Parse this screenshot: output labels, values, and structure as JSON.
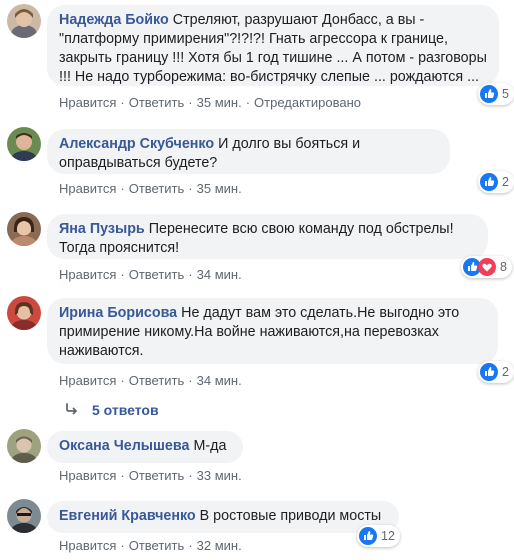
{
  "comments": [
    {
      "author": "Надежда Бойко",
      "text": "Стреляют, разрушают Донбасс, а вы - \"платформу примирения\"?!?!?! Гнать агрессора к границе, закрыть границу !!! Хотя бы 1 год тишине ... А потом - разговоры !!! Не надо турборежима: во-бистрячку слепые ... рождаются ...",
      "like": "Нравится",
      "reply": "Ответить",
      "time": "35 мин.",
      "edited": "Отредактировано",
      "reactions_count": "5",
      "reactions": [
        "like-icon"
      ]
    },
    {
      "author": "Александр Скубченко",
      "text": "И долго вы бояться и оправдываться будете?",
      "like": "Нравится",
      "reply": "Ответить",
      "time": "35 мин.",
      "reactions_count": "2",
      "reactions": [
        "like-icon"
      ]
    },
    {
      "author": "Яна Пузырь",
      "text": "Перенесите всю свою команду под обстрелы! Тогда прояснится!",
      "like": "Нравится",
      "reply": "Ответить",
      "time": "34 мин.",
      "reactions_count": "8",
      "reactions": [
        "like-icon",
        "love-icon"
      ]
    },
    {
      "author": "Ирина Борисова",
      "text": "Не дадут вам это сделать.Не выгодно это примирение никому.На войне наживаются,на перевозках наживаются.",
      "like": "Нравится",
      "reply": "Ответить",
      "time": "34 мин.",
      "reactions_count": "2",
      "reactions": [
        "like-icon"
      ]
    },
    {
      "author": "Оксана Челышева",
      "text": "М-да",
      "like": "Нравится",
      "reply": "Ответить",
      "time": "33 мин."
    },
    {
      "author": "Евгений Кравченко",
      "text": "В ростовые приводи мосты",
      "like": "Нравится",
      "reply": "Ответить",
      "time": "32 мин.",
      "reactions_count": "12",
      "reactions": [
        "like-icon"
      ]
    }
  ],
  "replies_label": "5 ответов",
  "colors": {
    "link": "#385898",
    "bubble": "#f2f3f5",
    "meta": "#606770",
    "like_blue": "#1877f2",
    "love_red": "#f33e58"
  }
}
